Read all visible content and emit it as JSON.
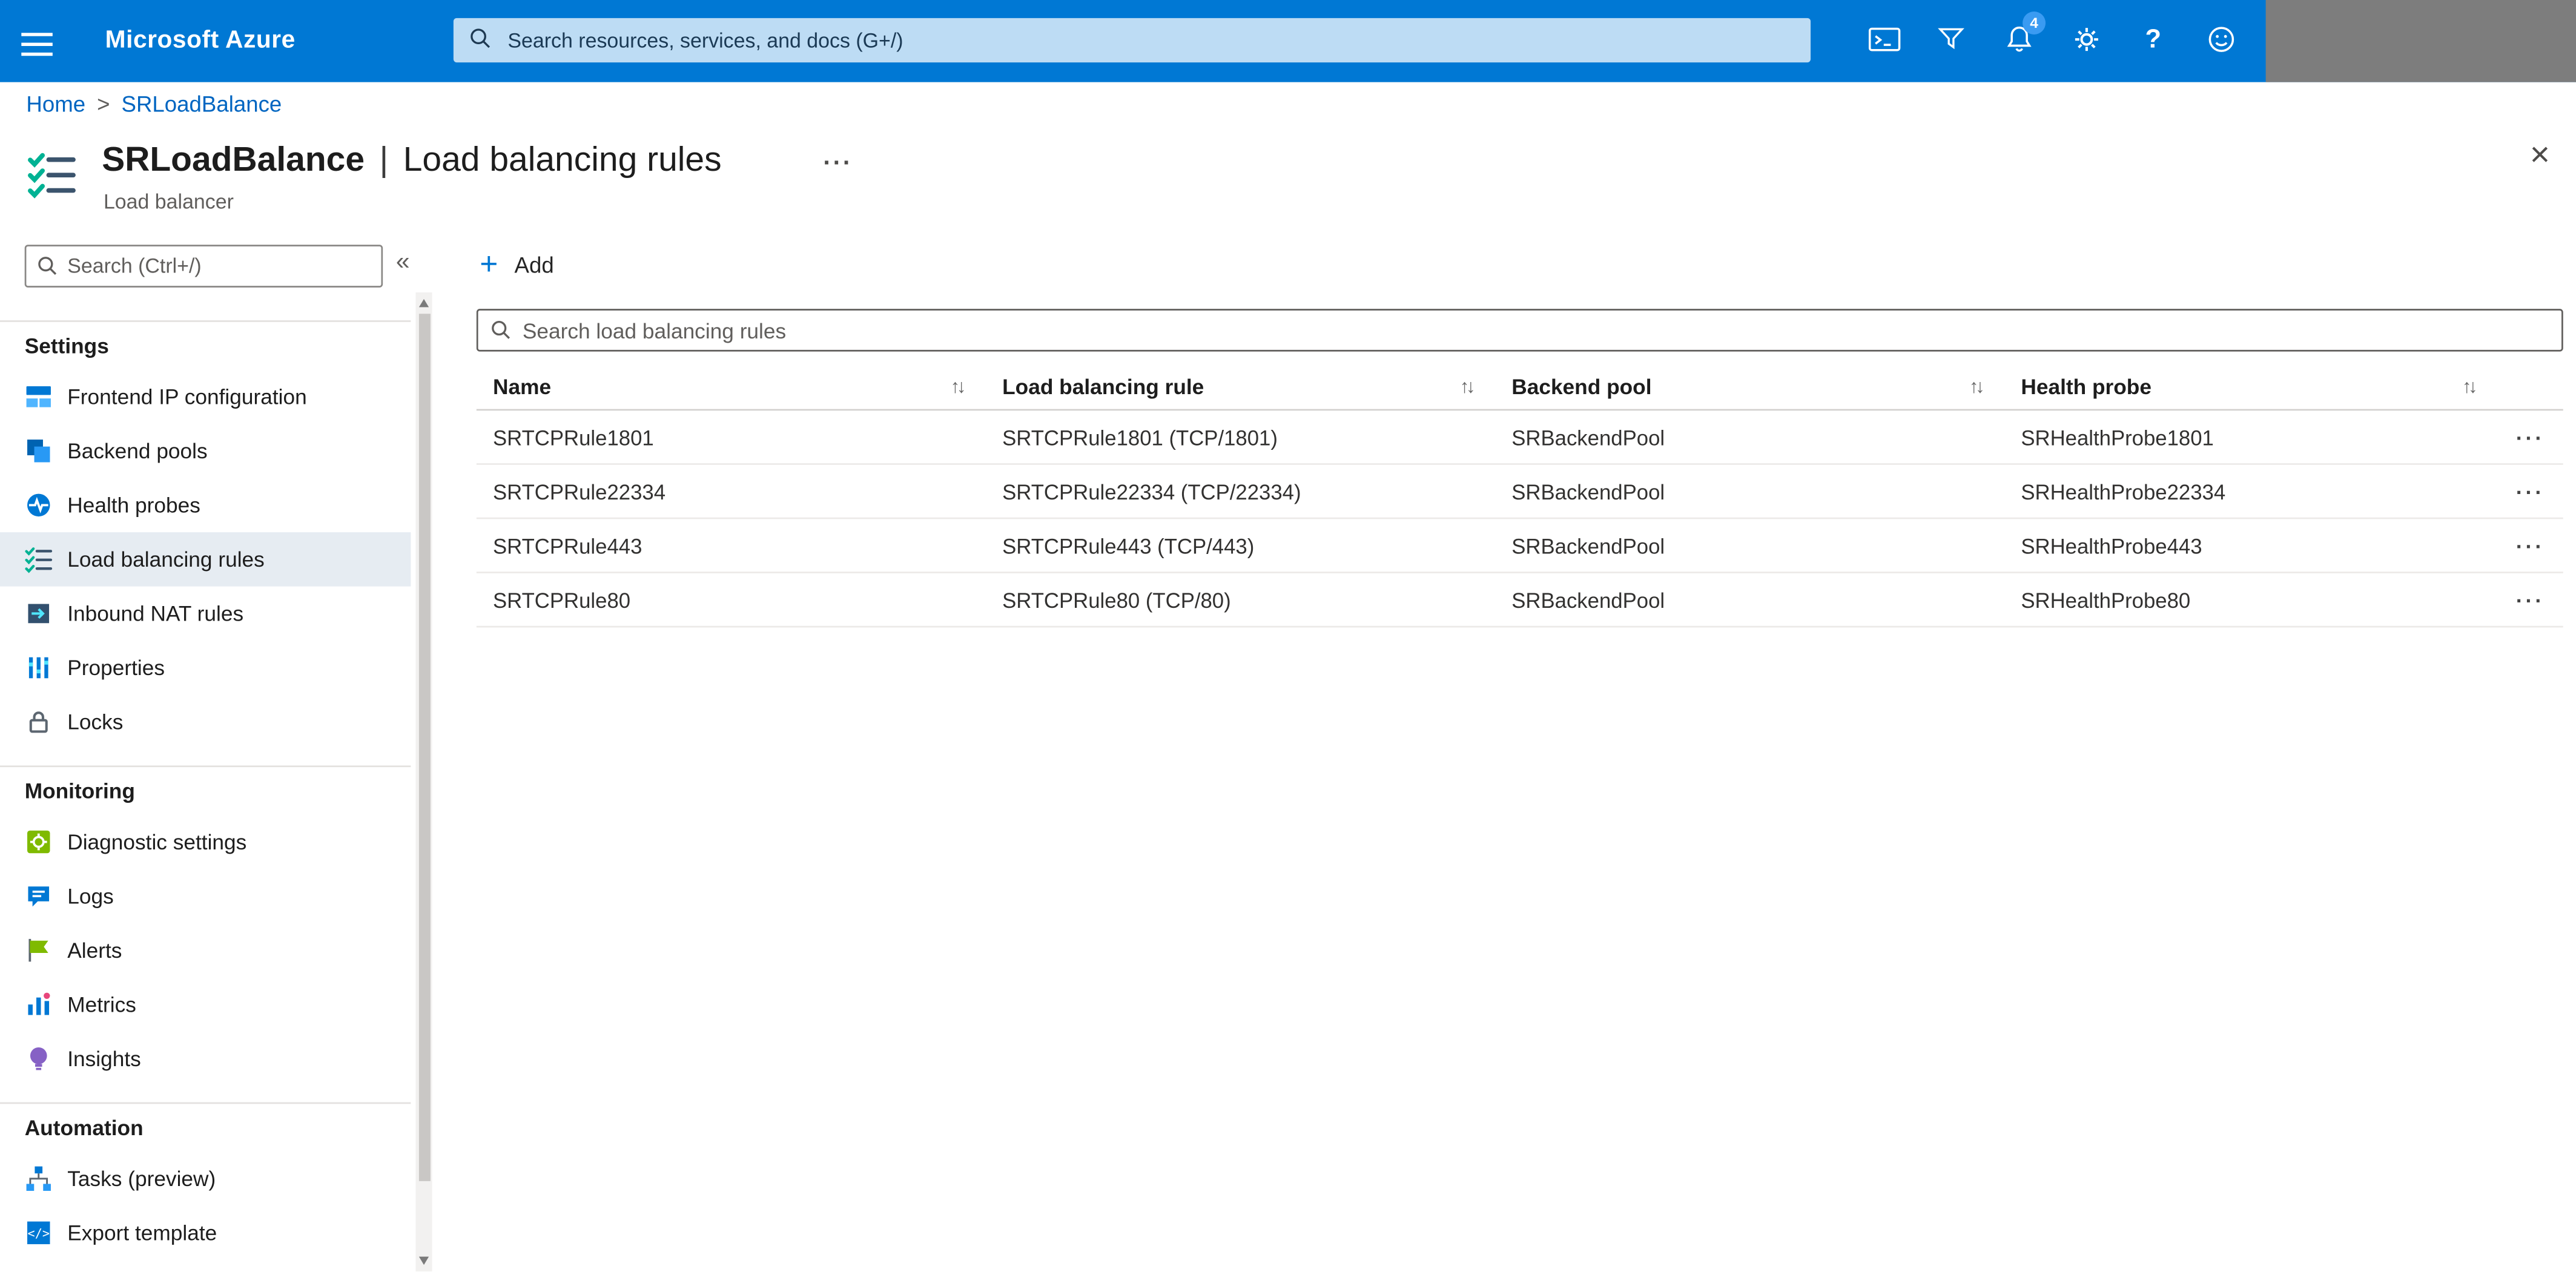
{
  "topbar": {
    "brand": "Microsoft Azure",
    "search_placeholder": "Search resources, services, and docs (G+/)",
    "notification_count": "4"
  },
  "breadcrumb": {
    "home": "Home",
    "separator": ">",
    "current": "SRLoadBalance"
  },
  "page": {
    "resource_name": "SRLoadBalance",
    "separator": "|",
    "blade_name": "Load balancing rules",
    "resource_type": "Load balancer"
  },
  "glyphs": {
    "more": "···",
    "close": "×",
    "collapse": "«",
    "sort": "↑↓",
    "plus": "+"
  },
  "sidebar": {
    "search_placeholder": "Search (Ctrl+/)",
    "sections": [
      {
        "label": "Settings",
        "items": [
          {
            "label": "Frontend IP configuration"
          },
          {
            "label": "Backend pools"
          },
          {
            "label": "Health probes"
          },
          {
            "label": "Load balancing rules",
            "selected": true
          },
          {
            "label": "Inbound NAT rules"
          },
          {
            "label": "Properties"
          },
          {
            "label": "Locks"
          }
        ]
      },
      {
        "label": "Monitoring",
        "items": [
          {
            "label": "Diagnostic settings"
          },
          {
            "label": "Logs"
          },
          {
            "label": "Alerts"
          },
          {
            "label": "Metrics"
          },
          {
            "label": "Insights"
          }
        ]
      },
      {
        "label": "Automation",
        "items": [
          {
            "label": "Tasks (preview)"
          },
          {
            "label": "Export template"
          }
        ]
      }
    ]
  },
  "main": {
    "add_label": "Add",
    "search_placeholder": "Search load balancing rules",
    "table": {
      "columns": [
        "Name",
        "Load balancing rule",
        "Backend pool",
        "Health probe"
      ],
      "rows": [
        {
          "name": "SRTCPRule1801",
          "rule": "SRTCPRule1801 (TCP/1801)",
          "backend_pool": "SRBackendPool",
          "health_probe": "SRHealthProbe1801"
        },
        {
          "name": "SRTCPRule22334",
          "rule": "SRTCPRule22334 (TCP/22334)",
          "backend_pool": "SRBackendPool",
          "health_probe": "SRHealthProbe22334"
        },
        {
          "name": "SRTCPRule443",
          "rule": "SRTCPRule443 (TCP/443)",
          "backend_pool": "SRBackendPool",
          "health_probe": "SRHealthProbe443"
        },
        {
          "name": "SRTCPRule80",
          "rule": "SRTCPRule80 (TCP/80)",
          "backend_pool": "SRBackendPool",
          "health_probe": "SRHealthProbe80"
        }
      ]
    }
  },
  "colors": {
    "topbar_bg": "#0078d4",
    "link": "#0065c1",
    "selected_item_bg": "#e6ecf2",
    "accent": "#0078d4"
  }
}
